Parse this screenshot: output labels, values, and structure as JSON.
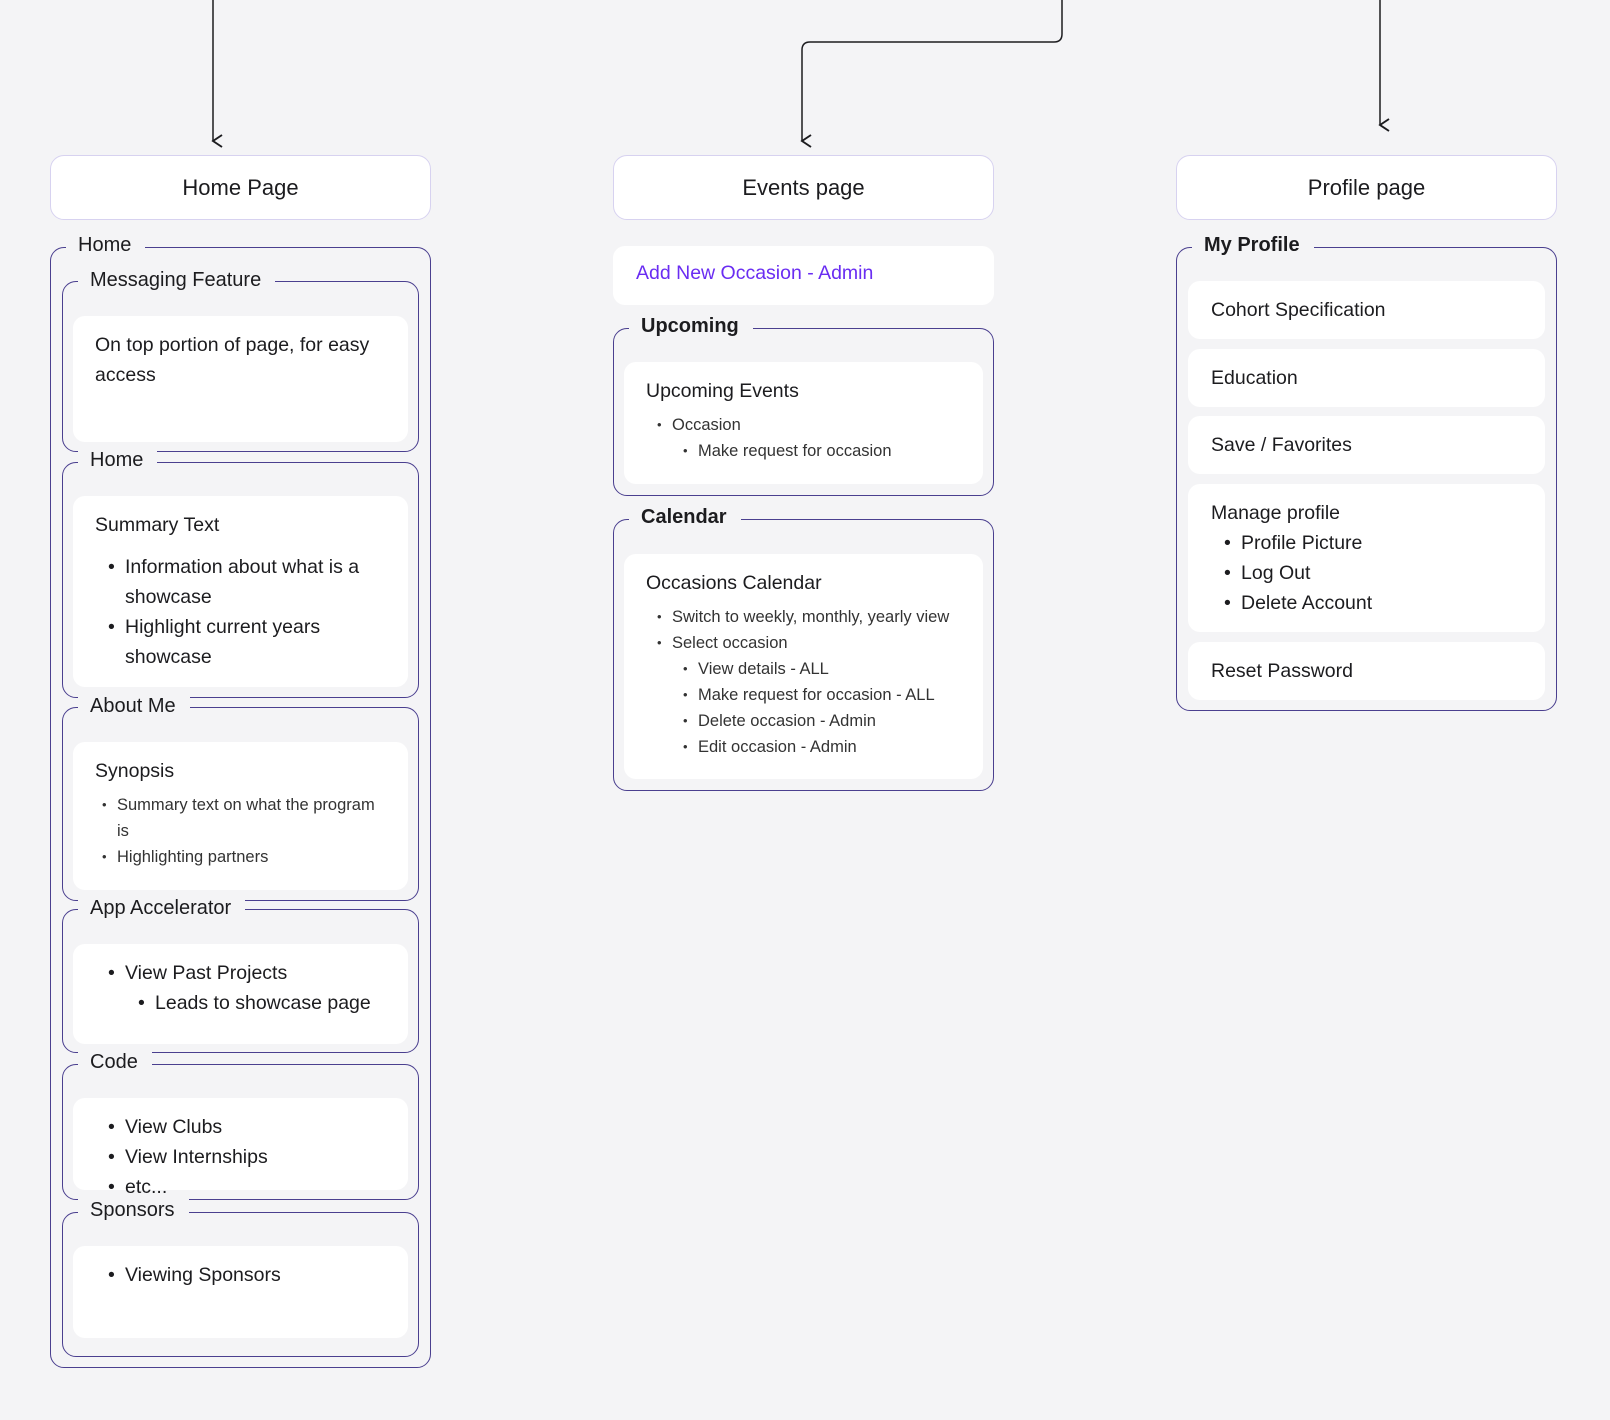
{
  "columns": {
    "home": {
      "title": "Home Page",
      "outer_label": "Home",
      "sections": {
        "messaging": {
          "label": "Messaging Feature",
          "text": "On top portion of page, for easy access"
        },
        "home": {
          "label": "Home",
          "heading": "Summary Text",
          "items": [
            "Information about what is a showcase",
            "Highlight current years showcase"
          ]
        },
        "about": {
          "label": "About Me",
          "heading": "Synopsis",
          "items": [
            "Summary text on what the program is",
            "Highlighting partners"
          ]
        },
        "accelerator": {
          "label": "App Accelerator",
          "item": "View Past Projects",
          "subitem": "Leads to showcase page"
        },
        "code": {
          "label": "Code",
          "items": [
            "View Clubs",
            "View Internships",
            "etc..."
          ]
        },
        "sponsors": {
          "label": "Sponsors",
          "items": [
            "Viewing Sponsors"
          ]
        }
      }
    },
    "events": {
      "title": "Events page",
      "add_link": "Add New Occasion - Admin",
      "upcoming": {
        "label": "Upcoming",
        "heading": "Upcoming Events",
        "item": "Occasion",
        "subitem": "Make request for occasion"
      },
      "calendar": {
        "label": "Calendar",
        "heading": "Occasions Calendar",
        "items": [
          "Switch to weekly, monthly, yearly view",
          "Select occasion"
        ],
        "subitems": [
          "View details - ALL",
          "Make request for occasion - ALL",
          "Delete occasion - Admin",
          "Edit occasion - Admin"
        ]
      }
    },
    "profile": {
      "title": "Profile page",
      "group_label": "My Profile",
      "items": [
        "Cohort Specification",
        "Education",
        "Save / Favorites"
      ],
      "manage": {
        "heading": "Manage profile",
        "items": [
          "Profile Picture",
          "Log Out",
          "Delete Account"
        ]
      },
      "reset": "Reset Password"
    }
  },
  "colors": {
    "border": "#4a3f8f",
    "title_border": "#d7d2f0",
    "link": "#6a2df2",
    "background": "#f4f4f6"
  }
}
